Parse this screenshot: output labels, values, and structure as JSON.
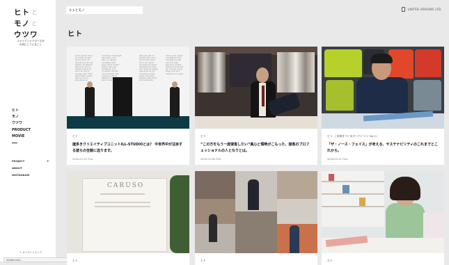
{
  "sidebar": {
    "logo": [
      {
        "main": "ヒト",
        "to": "と"
      },
      {
        "main": "モノ",
        "to": "と"
      },
      {
        "main": "ウツワ",
        "to": ""
      }
    ],
    "tagline_line1": "ユナイテッドアローズが",
    "tagline_line2": "大切にしていること",
    "nav_main": [
      "ヒト",
      "モノ",
      "ウツワ",
      "PRODUCT",
      "MOVIE"
    ],
    "nav_sub": [
      "PROJECT",
      "ABOUT",
      "INSTAGRAM"
    ],
    "nav_sub_plus": "+",
    "shop_link": "オンラインストア",
    "url_bar": "hitotomono..."
  },
  "header": {
    "search_value": "ヒトとモノ",
    "brand": "UNITED ARROWS LTD.",
    "page_title": "ヒト"
  },
  "cards": [
    {
      "category": "ヒト",
      "title": "謎多きクリエイティブユニットILL-STUDIOとは？ 今世界中が注目する彼らの全貌に迫ります。",
      "date": "2020.03.13 THU."
    },
    {
      "category": "ヒト",
      "title": "“この方をもう一度接客したい”真心と情熱がこもった、接客のプロフェッショナルの人となりとは。",
      "date": "2020.03.18 THU."
    },
    {
      "category": "ヒト　/ 未来をつくるキーパーソン Vol.2 /",
      "title": "「ザ・ノース・フェイス」が考える、サステナビリティのこれまでとこれから。",
      "date": "2020.03.12 THU."
    },
    {
      "category": "ヒト",
      "title": "",
      "date": ""
    },
    {
      "category": "ヒト",
      "title": "",
      "date": ""
    },
    {
      "category": "ヒト",
      "title": "",
      "date": ""
    }
  ],
  "images": {
    "caruso_sign": "CARUSO"
  },
  "colors": {
    "background": "#e9e9e9",
    "sidebar": "#ffffff",
    "floor_teal": "#0d3a45"
  }
}
